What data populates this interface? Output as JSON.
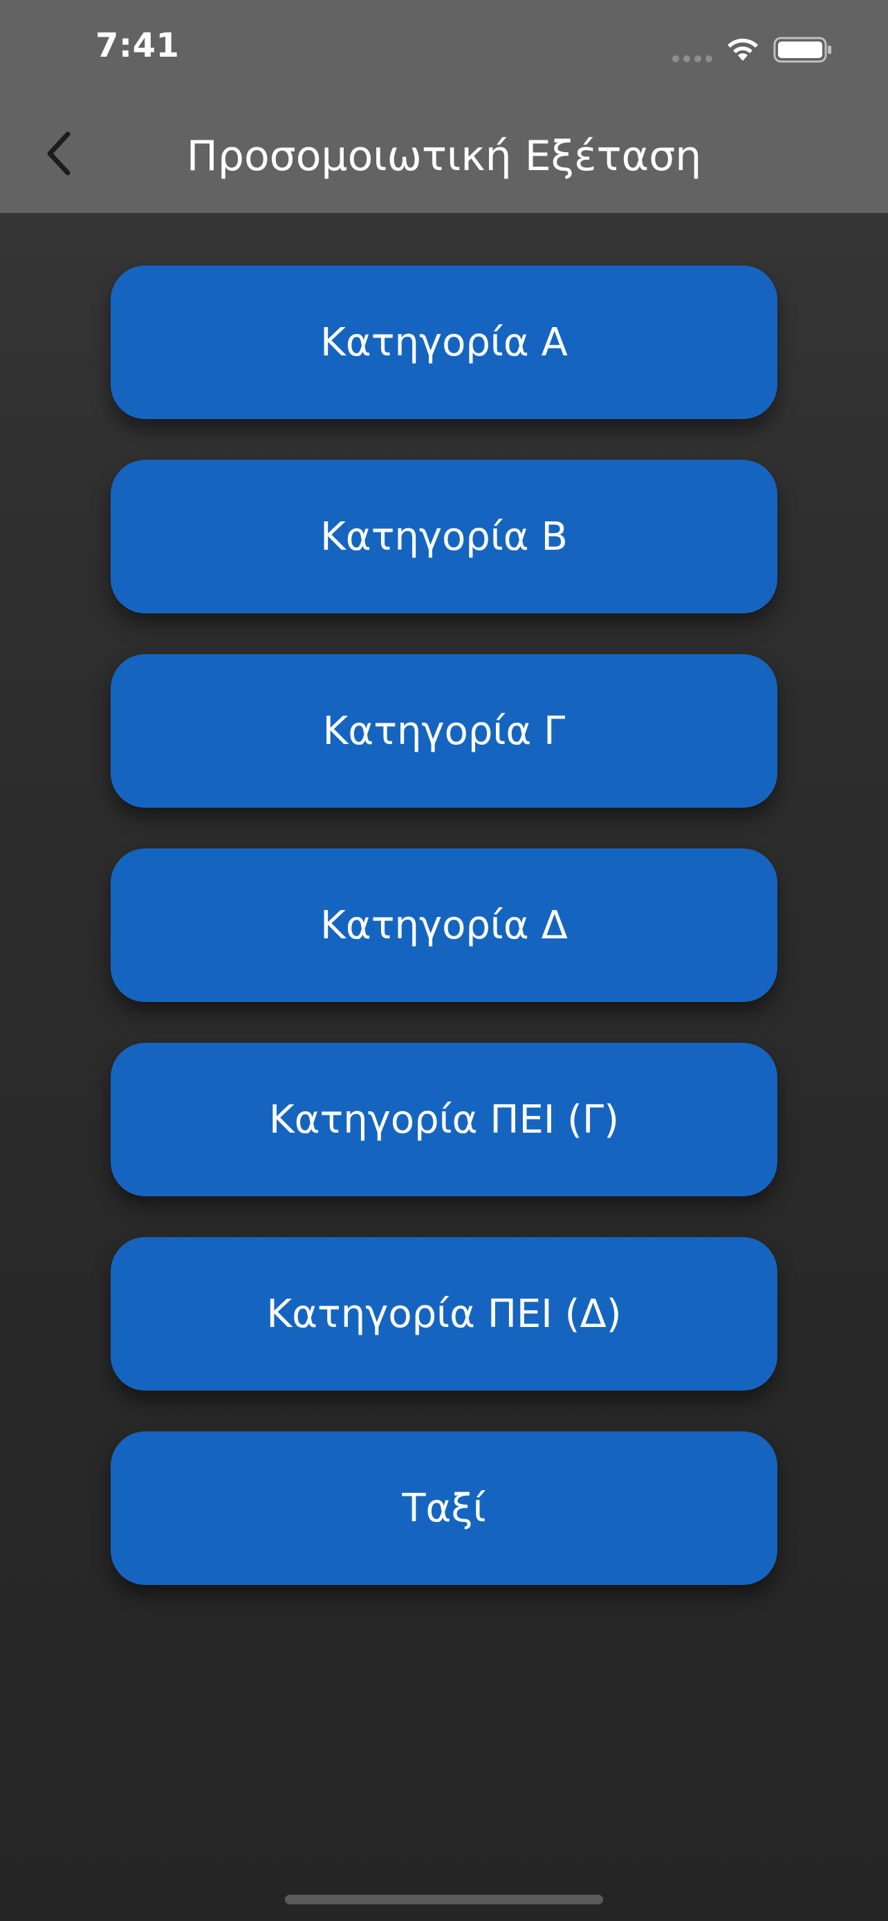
{
  "status_bar": {
    "time": "7:41",
    "icons": [
      "cellular-signal-icon",
      "wifi-icon",
      "battery-icon"
    ]
  },
  "nav": {
    "back_icon": "chevron-left-icon",
    "title": "Προσομοιωτική Εξέταση"
  },
  "categories": [
    {
      "label": "Κατηγορία Α"
    },
    {
      "label": "Κατηγορία Β"
    },
    {
      "label": "Κατηγορία Γ"
    },
    {
      "label": "Κατηγορία Δ"
    },
    {
      "label": "Κατηγορία ΠΕΙ (Γ)"
    },
    {
      "label": "Κατηγορία ΠΕΙ (Δ)"
    },
    {
      "label": "Ταξί"
    }
  ],
  "colors": {
    "header_bg": "#636363",
    "button_bg": "#1565c0",
    "text": "#ffffff",
    "page_bg": "#2a2a2a"
  }
}
